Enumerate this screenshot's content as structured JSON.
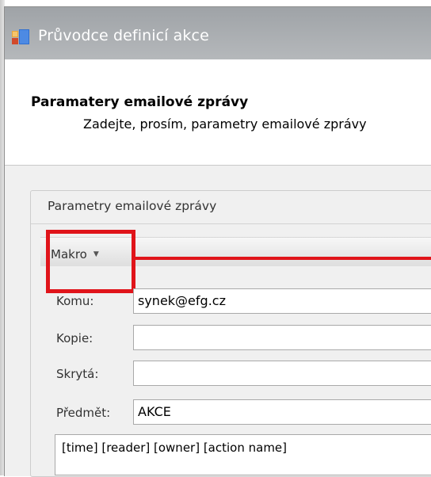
{
  "window": {
    "title": "Průvodce definicí akce",
    "icon": "app-icon"
  },
  "header": {
    "title": "Paramatery emailové zprávy",
    "subtitle": "Zadejte, prosím, parametry emailové zprávy"
  },
  "group": {
    "title": "Parametry emailové zprávy"
  },
  "toolbar": {
    "makro_label": "Makro",
    "makro_icon": "chevron-down-icon"
  },
  "fields": {
    "to_label": "Komu:",
    "to_value": "synek@efg.cz",
    "cc_label": "Kopie:",
    "cc_value": "",
    "bcc_label": "Skrytá:",
    "bcc_value": "",
    "subject_label": "Předmět:",
    "subject_value": "AKCE"
  },
  "body": {
    "text": "[time] [reader] [owner] [action name]"
  },
  "annotation": {
    "color": "#e0141a"
  }
}
